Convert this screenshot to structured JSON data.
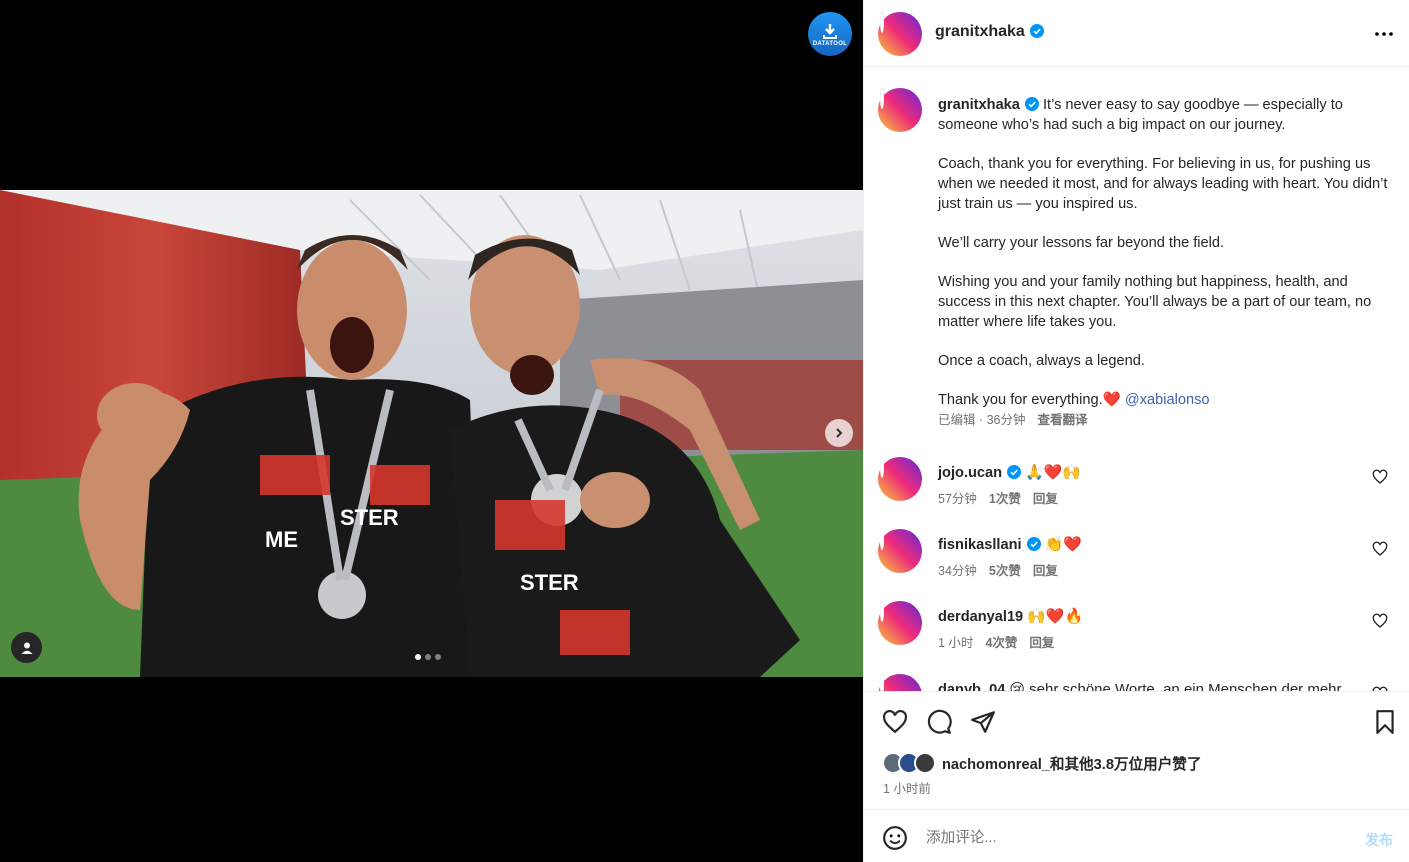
{
  "media": {
    "download_label": "DATATOOL",
    "carousel_total": 3,
    "carousel_active": 1
  },
  "post": {
    "username": "granitxhaka",
    "caption": {
      "intro": "It’s never easy to say goodbye — especially to someone who’s had such a big impact on our journey.",
      "p1": "Coach, thank you for everything. For believing in us, for pushing us when we needed it most, and for always leading with heart. You didn’t just train us — you inspired us.",
      "p2": "We’ll carry your lessons far beyond the field.",
      "p3": "Wishing you and your family nothing but happiness, health, and success in this next chapter. You’ll always be a part of our team, no matter where life takes you.",
      "p4": "Once a coach, always a legend.",
      "p5": "Thank you for everything.",
      "p5_emoji": "❤️",
      "mention": "@xabialonso",
      "meta": "已编辑 · 36分钟",
      "translate": "查看翻译"
    },
    "comments": [
      {
        "user": "jojo.ucan",
        "verified": true,
        "text": "🙏❤️🙌",
        "time": "57分钟",
        "likes": "1次赞",
        "reply": "回复"
      },
      {
        "user": "fisnikasllani",
        "verified": true,
        "text": "👏❤️",
        "time": "34分钟",
        "likes": "5次赞",
        "reply": "回复"
      },
      {
        "user": "derdanyal19",
        "verified": false,
        "text": "🙌❤️🔥",
        "time": "1 小时",
        "likes": "4次赞",
        "reply": "回复"
      },
      {
        "user": "danyb_04",
        "verified": false,
        "text": "😢 sehr schöne Worte, an ein Menschen der mehr",
        "time": "",
        "likes": "",
        "reply": ""
      }
    ],
    "likes_text": "nachomonreal_和其他3.8万位用户赞了",
    "time_ago": "1 小时前",
    "comment_placeholder": "添加评论...",
    "post_button": "发布"
  },
  "colors": {
    "verified": "#0095f6",
    "heart": "#ed4956",
    "post_disabled": "#b3dbff"
  }
}
